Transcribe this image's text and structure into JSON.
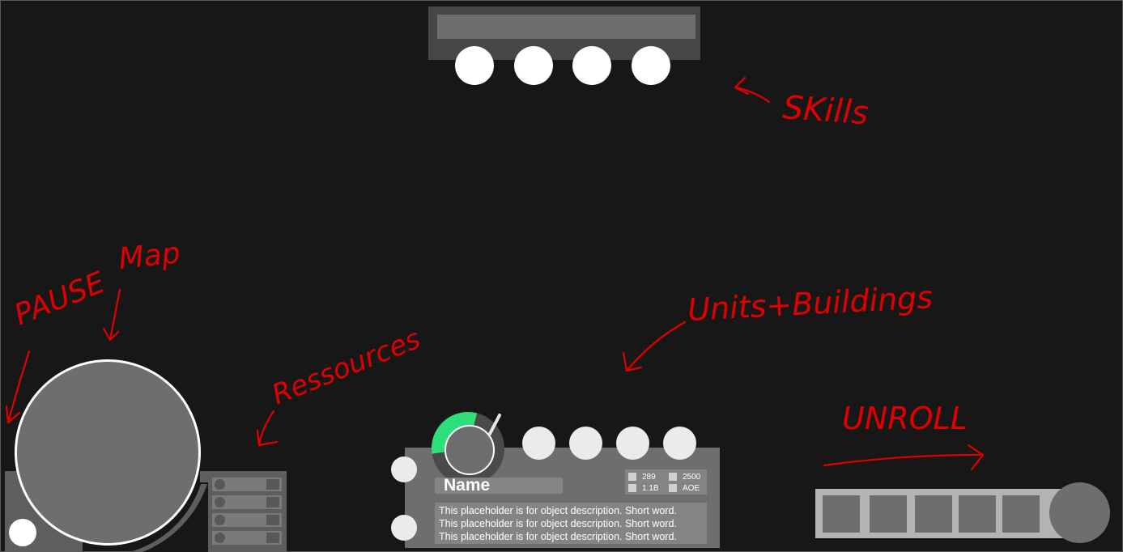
{
  "annotations": {
    "skills": "SKills",
    "pause": "PAUSE",
    "map": "Map",
    "resources": "Ressources",
    "units_buildings": "Units+Buildings",
    "unroll": "UNROLL"
  },
  "skills_bar": {
    "skill_count": 4
  },
  "resources": {
    "row_count": 4
  },
  "selection": {
    "name": "Name",
    "health_fraction": 0.6,
    "stats": [
      {
        "value": "289"
      },
      {
        "value": "2500"
      },
      {
        "value": "1.1B"
      },
      {
        "value": "AOE"
      }
    ],
    "description_lines": [
      "This placeholder is for object description. Short word.",
      "This placeholder is for object description. Short word.",
      "This placeholder is for object description. Short word."
    ],
    "unit_slot_count": 4
  },
  "unroll_bar": {
    "slot_count": 5
  },
  "colors": {
    "background": "#171717",
    "panel": "#6e6e6e",
    "annotation": "#e00000",
    "health": "#2ee07a"
  }
}
